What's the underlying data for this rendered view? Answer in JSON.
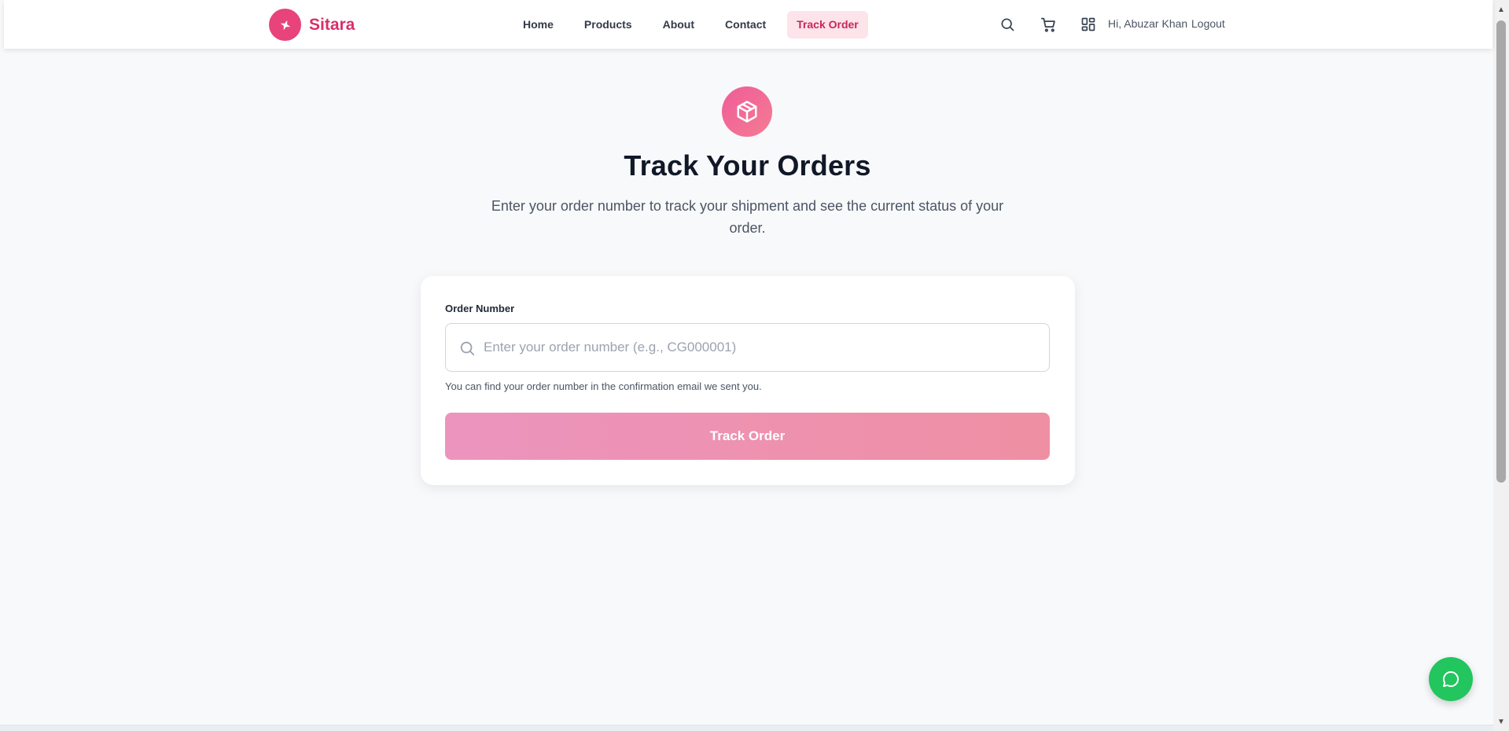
{
  "brand": {
    "name": "Sitara",
    "color": "#e8437a"
  },
  "nav": {
    "items": [
      {
        "label": "Home"
      },
      {
        "label": "Products"
      },
      {
        "label": "About"
      },
      {
        "label": "Contact"
      },
      {
        "label": "Track Order",
        "active": true
      }
    ]
  },
  "header_actions": {
    "search_icon": "search-icon",
    "cart_icon": "cart-icon",
    "dashboard_icon": "grid-icon",
    "greeting": "Hi, Abuzar Khan",
    "logout_label": "Logout"
  },
  "hero": {
    "icon": "package-icon",
    "title": "Track Your Orders",
    "subtitle": "Enter your order number to track your shipment and see the current status of your order."
  },
  "form": {
    "label": "Order Number",
    "input_value": "",
    "placeholder": "Enter your order number (e.g., CG000001)",
    "help_text": "You can find your order number in the confirmation email we sent you.",
    "submit_label": "Track Order"
  },
  "chat": {
    "icon": "chat-bubble-icon",
    "color": "#22c55e"
  },
  "colors": {
    "accent": "#e8437a",
    "accent_soft": "#fde3ea",
    "button": "#ee92b2"
  }
}
